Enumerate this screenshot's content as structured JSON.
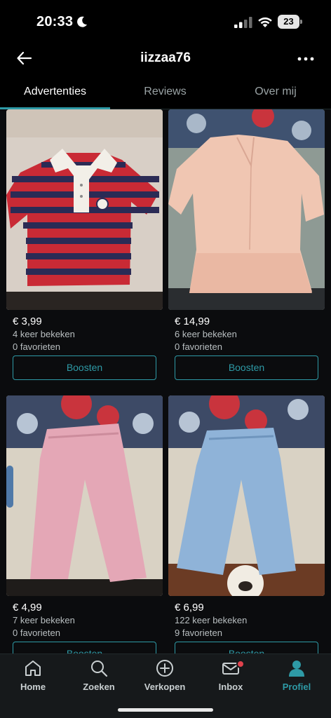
{
  "status": {
    "time": "20:33",
    "battery": "23"
  },
  "header": {
    "title": "iizzaa76"
  },
  "tabs": [
    {
      "label": "Advertenties",
      "active": true
    },
    {
      "label": "Reviews",
      "active": false
    },
    {
      "label": "Over mij",
      "active": false
    }
  ],
  "listings": [
    {
      "price": "€ 3,99",
      "views": "4 keer bekeken",
      "favorites": "0 favorieten",
      "button": "Boosten",
      "photo": "red-navy-striped-polo-top"
    },
    {
      "price": "€ 14,99",
      "views": "6 keer bekeken",
      "favorites": "0 favorieten",
      "button": "Boosten",
      "photo": "peach-ruffled-dress"
    },
    {
      "price": "€ 4,99",
      "views": "7 keer bekeken",
      "favorites": "0 favorieten",
      "button": "Boosten",
      "photo": "pink-wide-trousers"
    },
    {
      "price": "€ 6,99",
      "views": "122 keer bekeken",
      "favorites": "9 favorieten",
      "button": "Boosten",
      "photo": "light-blue-wide-trousers"
    }
  ],
  "nav": [
    {
      "label": "Home",
      "icon": "home-icon",
      "active": false
    },
    {
      "label": "Zoeken",
      "icon": "search-icon",
      "active": false
    },
    {
      "label": "Verkopen",
      "icon": "plus-circle-icon",
      "active": false
    },
    {
      "label": "Inbox",
      "icon": "mail-icon",
      "active": false
    },
    {
      "label": "Profiel",
      "icon": "profile-icon",
      "active": true
    }
  ],
  "colors": {
    "accent": "#2e9aa6",
    "background": "#0b0c0e",
    "badge": "#e0424d"
  }
}
